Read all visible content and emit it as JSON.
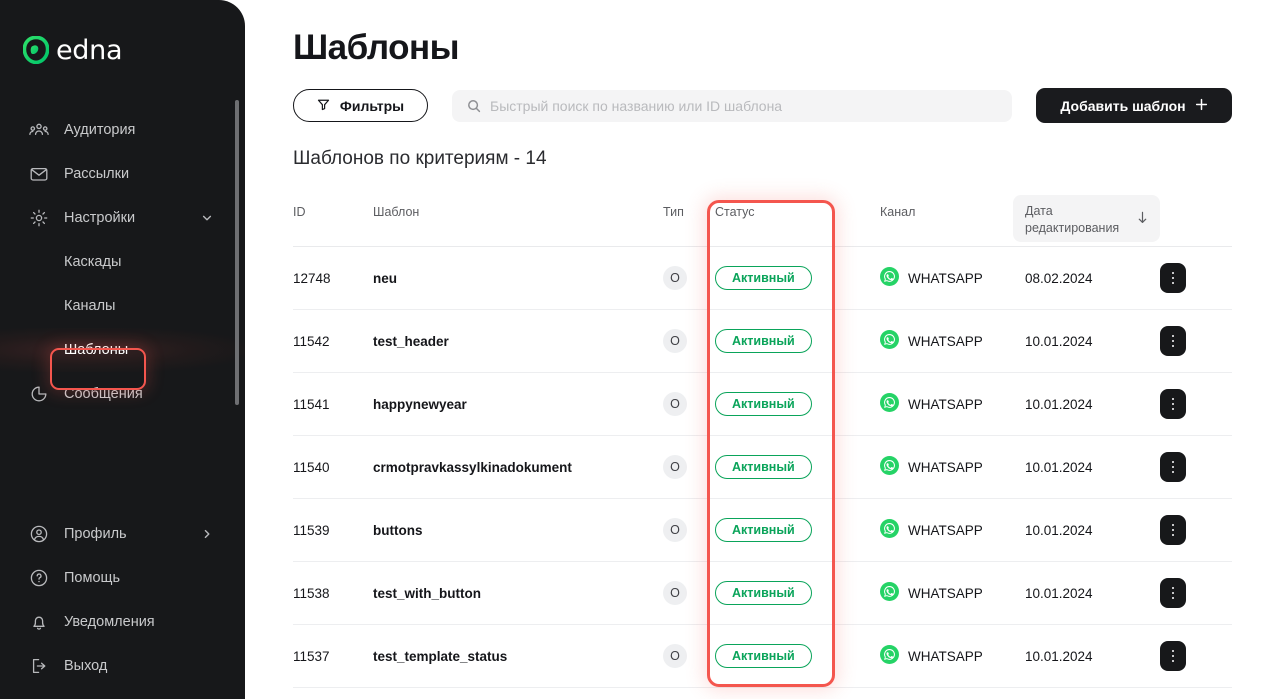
{
  "brand": {
    "name": "edna",
    "logo_icon": "edna-leaf-icon",
    "accent_green": "#22d362"
  },
  "sidebar": {
    "items": [
      {
        "label": "Аудитория",
        "icon": "people-group-icon"
      },
      {
        "label": "Рассылки",
        "icon": "envelope-icon"
      },
      {
        "label": "Настройки",
        "icon": "gear-icon",
        "chevron": "chevron-down-icon"
      }
    ],
    "sub_items": [
      {
        "label": "Каскады"
      },
      {
        "label": "Каналы"
      },
      {
        "label": "Шаблоны",
        "active": true,
        "highlighted": true
      }
    ],
    "items_after": [
      {
        "label": "Сообщения",
        "icon": "pie-chart-icon"
      }
    ],
    "collapse_icon": "arrow-left-icon",
    "bottom_items": [
      {
        "label": "Профиль",
        "icon": "user-circle-icon",
        "chevron": "chevron-right-icon"
      },
      {
        "label": "Помощь",
        "icon": "question-circle-icon"
      },
      {
        "label": "Уведомления",
        "icon": "bell-icon"
      },
      {
        "label": "Выход",
        "icon": "logout-icon"
      }
    ]
  },
  "main": {
    "title": "Шаблоны",
    "toolbar": {
      "filters_label": "Фильтры",
      "filters_icon": "filter-funnel-icon",
      "search_placeholder": "Быстрый поиск по названию или ID шаблона",
      "search_value": "",
      "search_icon": "search-icon",
      "add_label": "Добавить шаблон",
      "add_icon": "plus-icon"
    },
    "results_summary": "Шаблонов по критериям - 14",
    "table": {
      "columns": {
        "id": "ID",
        "name": "Шаблон",
        "type": "Тип",
        "status": "Статус",
        "channel": "Канал",
        "date_line1": "Дата",
        "date_line2": "редактирования",
        "sort_icon": "arrow-down-icon",
        "actions": ""
      },
      "rows": [
        {
          "id": "12748",
          "name": "neu",
          "type": "O",
          "status": "Активный",
          "channel": "WHATSAPP",
          "channel_icon": "whatsapp-icon",
          "date": "08.02.2024",
          "actions_icon": "kebab-menu-icon"
        },
        {
          "id": "11542",
          "name": "test_header",
          "type": "O",
          "status": "Активный",
          "channel": "WHATSAPP",
          "channel_icon": "whatsapp-icon",
          "date": "10.01.2024",
          "actions_icon": "kebab-menu-icon"
        },
        {
          "id": "11541",
          "name": "happynewyear",
          "type": "O",
          "status": "Активный",
          "channel": "WHATSAPP",
          "channel_icon": "whatsapp-icon",
          "date": "10.01.2024",
          "actions_icon": "kebab-menu-icon"
        },
        {
          "id": "11540",
          "name": "crmotpravkassylkinadokument",
          "type": "O",
          "status": "Активный",
          "channel": "WHATSAPP",
          "channel_icon": "whatsapp-icon",
          "date": "10.01.2024",
          "actions_icon": "kebab-menu-icon"
        },
        {
          "id": "11539",
          "name": "buttons",
          "type": "O",
          "status": "Активный",
          "channel": "WHATSAPP",
          "channel_icon": "whatsapp-icon",
          "date": "10.01.2024",
          "actions_icon": "kebab-menu-icon"
        },
        {
          "id": "11538",
          "name": "test_with_button",
          "type": "O",
          "status": "Активный",
          "channel": "WHATSAPP",
          "channel_icon": "whatsapp-icon",
          "date": "10.01.2024",
          "actions_icon": "kebab-menu-icon"
        },
        {
          "id": "11537",
          "name": "test_template_status",
          "type": "O",
          "status": "Активный",
          "channel": "WHATSAPP",
          "channel_icon": "whatsapp-icon",
          "date": "10.01.2024",
          "actions_icon": "kebab-menu-icon"
        }
      ]
    }
  },
  "annotations": {
    "highlight_color": "#f4564e",
    "boxes": [
      {
        "target": "sidebar-item-shablony"
      },
      {
        "target": "table-column-status"
      }
    ]
  }
}
